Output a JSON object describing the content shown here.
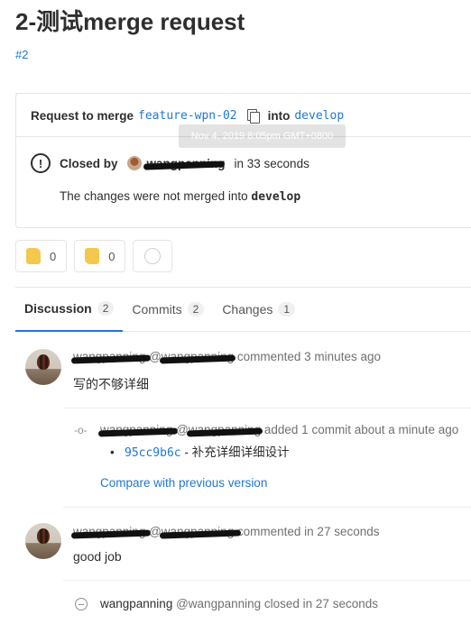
{
  "page": {
    "title": "2-测试merge request",
    "iid": "#2"
  },
  "merge_widget": {
    "request_to_merge": "Request to merge",
    "source_branch": "feature-wpn-02",
    "into": "into",
    "target_branch": "develop",
    "tooltip": "Nov 4, 2019 8:05pm GMT+0800",
    "closed_by": "Closed by",
    "closed_author": "wangpanning",
    "closed_time": "in 33 seconds",
    "not_merged_prefix": "The changes were not merged into",
    "not_merged_branch": "develop"
  },
  "awards": [
    {
      "name": "thumbsup",
      "count": "0"
    },
    {
      "name": "thumbsdown",
      "count": "0"
    }
  ],
  "tabs": [
    {
      "label": "Discussion",
      "count": "2",
      "active": true
    },
    {
      "label": "Commits",
      "count": "2",
      "active": false
    },
    {
      "label": "Changes",
      "count": "1",
      "active": false
    }
  ],
  "notes": [
    {
      "author": "wangpanning",
      "handle": "@wangpanning",
      "action": "commented 3 minutes ago",
      "body": "写的不够详细"
    },
    {
      "author": "wangpanning",
      "handle": "@wangpanning",
      "action": "added 1 commit about a minute ago",
      "commit_sha": "95cc9b6c",
      "commit_message": "- 补充详细详细设计",
      "compare_label": "Compare with previous version"
    },
    {
      "author": "wangpanning",
      "handle": "@wangpanning",
      "action": "commented in 27 seconds",
      "body": "good job"
    },
    {
      "author": "wangpanning",
      "handle": "@wangpanning",
      "action": "closed in 27 seconds"
    }
  ],
  "icons": {
    "copy": "copy-icon",
    "alert": "alert-circle-icon",
    "commit": "commit-icon",
    "closed": "closed-icon",
    "smiley": "smiley-icon"
  }
}
